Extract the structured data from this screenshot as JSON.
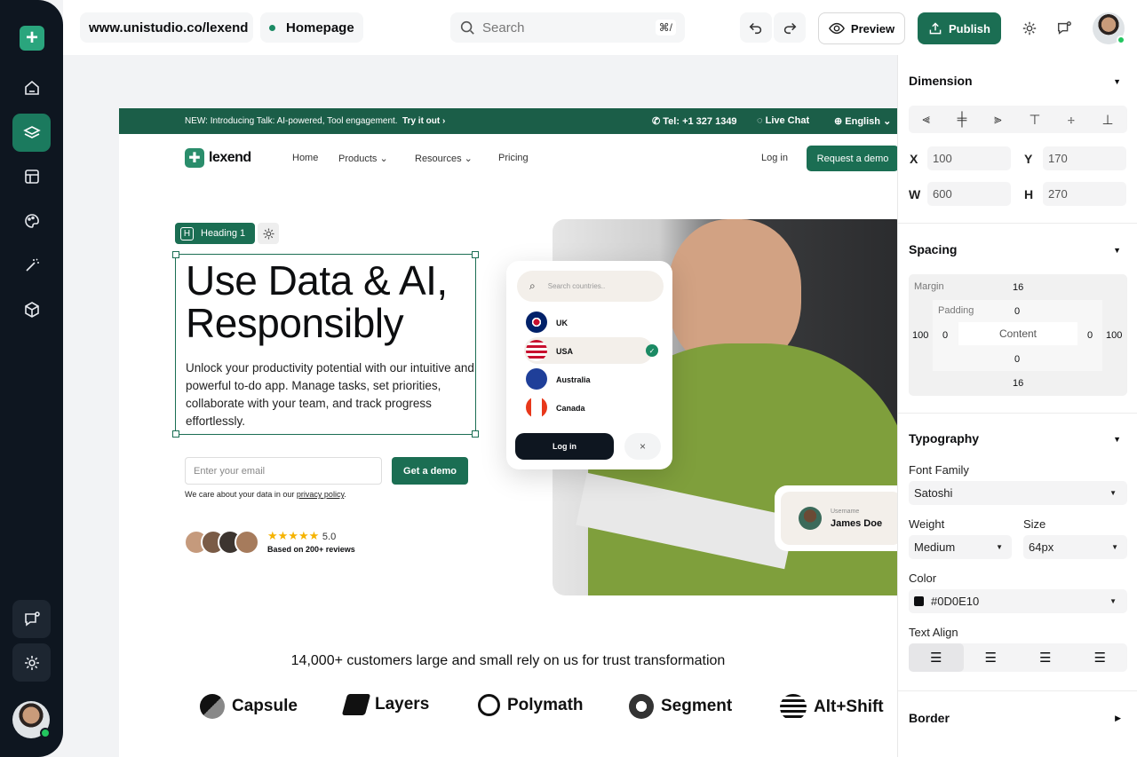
{
  "sidebar": {
    "items": [
      {
        "icon": "home-icon"
      },
      {
        "icon": "layers-icon",
        "active": true
      },
      {
        "icon": "layout-icon"
      },
      {
        "icon": "palette-icon"
      },
      {
        "icon": "magic-wand-icon"
      },
      {
        "icon": "cube-icon"
      }
    ],
    "bottom": [
      {
        "icon": "chat-icon"
      },
      {
        "icon": "gear-icon"
      }
    ]
  },
  "topbar": {
    "url": "www.unistudio.co/lexend",
    "page": "Homepage",
    "search_placeholder": "Search",
    "search_shortcut": "⌘/",
    "preview_label": "Preview",
    "publish_label": "Publish"
  },
  "site": {
    "announcement": "NEW: Introducing Talk: AI-powered, Tool engagement.",
    "announcement_link": "Try it out",
    "phone": "Tel: +1 327 1349",
    "live_chat": "Live Chat",
    "language": "English",
    "brand": "lexend",
    "nav": [
      "Home",
      "Products",
      "Resources",
      "Pricing"
    ],
    "login": "Log in",
    "cta": "Request a demo",
    "selection_label": "Heading 1",
    "heading_line1": "Use Data & AI,",
    "heading_line2": "Responsibly",
    "body": "Unlock your productivity potential with our intuitive and powerful to-do app. Manage tasks, set priorities, collaborate with your team, and track progress effortlessly.",
    "email_placeholder": "Enter your email",
    "get_demo": "Get a demo",
    "privacy_prefix": "We care about your data in our ",
    "privacy_link": "privacy policy",
    "privacy_suffix": ".",
    "rating": "5.0",
    "rating_note": "Based on 200+ reviews",
    "stars": 5,
    "country_search_placeholder": "Search countries..",
    "countries": [
      "UK",
      "USA",
      "Australia",
      "Canada"
    ],
    "selected_country": "USA",
    "card_login": "Log in",
    "user_label": "Username",
    "user_name": "James Doe",
    "customers": "14,000+ customers large and small rely on us for trust transformation",
    "logos": [
      "Capsule",
      "Layers",
      "Polymath",
      "Segment",
      "Alt+Shift"
    ]
  },
  "panel": {
    "dimension": {
      "title": "Dimension",
      "x_label": "X",
      "x": "100",
      "y_label": "Y",
      "y": "170",
      "w_label": "W",
      "w": "600",
      "h_label": "H",
      "h": "270"
    },
    "spacing": {
      "title": "Spacing",
      "margin_label": "Margin",
      "margin_top": "16",
      "margin_bottom": "16",
      "margin_left": "100",
      "margin_right": "100",
      "padding_label": "Padding",
      "padding_top": "0",
      "padding_bottom": "0",
      "padding_left": "0",
      "padding_right": "0",
      "content_label": "Content"
    },
    "typography": {
      "title": "Typography",
      "font_family_label": "Font Family",
      "font_family": "Satoshi",
      "weight_label": "Weight",
      "weight": "Medium",
      "size_label": "Size",
      "size": "64px",
      "color_label": "Color",
      "color": "#0D0E10",
      "text_align_label": "Text Align",
      "text_align": "left"
    },
    "border": {
      "title": "Border"
    }
  },
  "colors": {
    "brand": "#1b6e53",
    "dark": "#0e1620"
  }
}
